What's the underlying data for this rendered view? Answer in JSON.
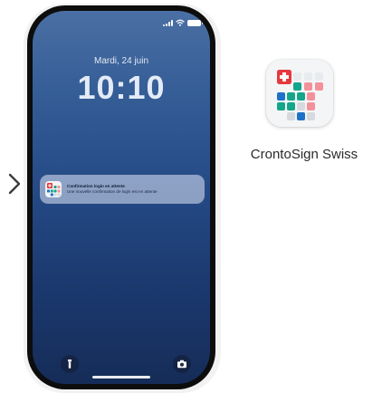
{
  "lockscreen": {
    "date": "Mardi, 24 juin",
    "time": "10:10"
  },
  "notification": {
    "title": "Confirmation login en attente",
    "body": "Une nouvelle confirmation de login est en attente"
  },
  "app": {
    "name": "CrontoSign Swiss"
  },
  "icons": {
    "status": [
      "signal-icon",
      "wifi-icon",
      "battery-icon"
    ],
    "quick_actions": [
      "flashlight-icon",
      "camera-icon"
    ],
    "navigation": "chevron-right-icon"
  },
  "colors": {
    "swiss_red": "#e5393d",
    "teal": "#15a58a",
    "blue": "#1d72c8",
    "pink": "#f3919a",
    "light_grey": "#d6d9dd",
    "screen_top": "#4a6fa4",
    "screen_bottom": "#152c58"
  }
}
